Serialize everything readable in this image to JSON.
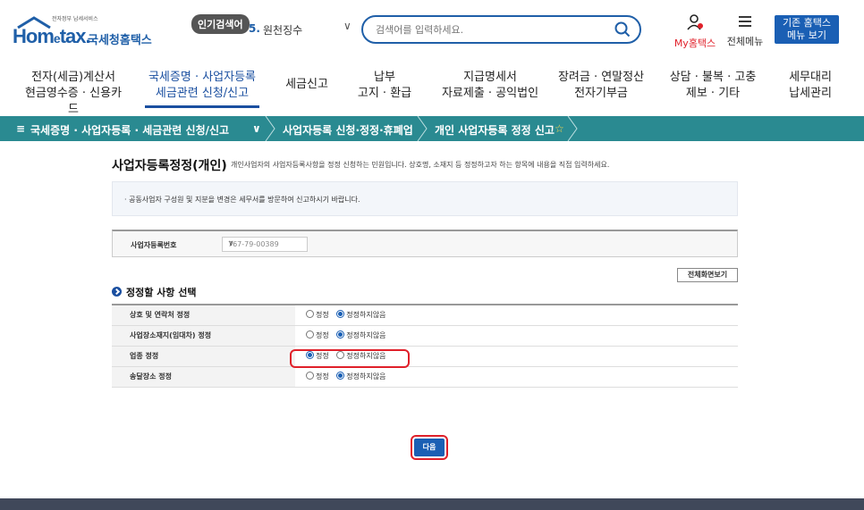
{
  "header": {
    "logo_small": "전자정부 납세서비스",
    "logo_main_a": "Hom",
    "logo_main_e": "e",
    "logo_main_b": "tax.",
    "logo_kor": "국세청홈택스",
    "popular_badge": "인기검색어",
    "popular_num": "5.",
    "popular_text": "원천징수",
    "search_placeholder": "검색어를 입력하세요.",
    "myhome_label": "My홈택스",
    "allmenu_label": "전체메뉴",
    "old_menu_line1": "기존 홈택스",
    "old_menu_line2": "메뉴 보기"
  },
  "gnb": [
    {
      "line1": "전자(세금)계산서",
      "line2": "현금영수증 · 신용카드",
      "active": false
    },
    {
      "line1": "국세증명 · 사업자등록",
      "line2": "세금관련 신청/신고",
      "active": true
    },
    {
      "line1": "세금신고",
      "line2": "",
      "active": false
    },
    {
      "line1": "납부",
      "line2": "고지 · 환급",
      "active": false
    },
    {
      "line1": "지급명세서",
      "line2": "자료제출 · 공익법인",
      "active": false
    },
    {
      "line1": "장려금 · 연말정산",
      "line2": "전자기부금",
      "active": false
    },
    {
      "line1": "상담 · 불복 · 고충",
      "line2": "제보 · 기타",
      "active": false
    },
    {
      "line1": "세무대리",
      "line2": "납세관리",
      "active": false
    }
  ],
  "breadcrumb": {
    "menu_icon": "≡",
    "level1": "국세증명 · 사업자등록 · 세금관련 신청/신고",
    "level2": "사업자등록 신청·정정·휴폐업",
    "level3": "개인 사업자등록 정정 신고"
  },
  "page": {
    "title": "사업자등록정정(개인)",
    "description": "개인사업자의 사업자등록사항을 정정 신청하는 민원입니다. 상호명, 소재지 등 정정하고자 하는 항목에 내용을 직접 입력하세요.",
    "notice": "· 공동사업자 구성원 및 지분을 변경은 세무서를 방문하여 신고하시기 바랍니다.",
    "reg_label": "사업자등록번호",
    "reg_value": "767-79-00389",
    "full_screen_button": "전체화면보기",
    "section_title": "정정할 사항 선택",
    "next_button": "다음"
  },
  "options": [
    {
      "label": "상호 및 연락처 정정",
      "yes": "정정",
      "no": "정정하지않음",
      "selected": "no"
    },
    {
      "label": "사업장소재지(임대차) 정정",
      "yes": "정정",
      "no": "정정하지않음",
      "selected": "no"
    },
    {
      "label": "업종 정정",
      "yes": "정정",
      "no": "정정하지않음",
      "selected": "yes"
    },
    {
      "label": "송달장소 정정",
      "yes": "정정",
      "no": "정정하지않음",
      "selected": "no"
    }
  ],
  "colors": {
    "brand_blue": "#1a5fb4",
    "teal_bar": "#2a8a91",
    "highlight_red": "#e0202a"
  }
}
